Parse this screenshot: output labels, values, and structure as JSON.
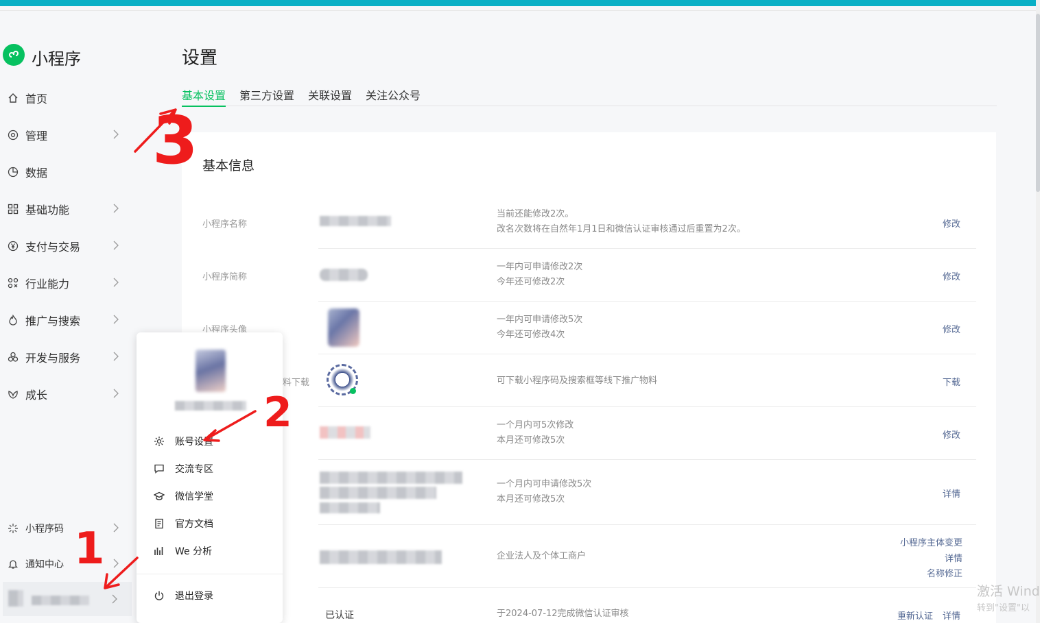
{
  "brand": {
    "name": "小程序"
  },
  "sidebar": {
    "items": [
      {
        "label": "首页",
        "icon": "home-icon"
      },
      {
        "label": "管理",
        "icon": "settings-circle-icon"
      },
      {
        "label": "数据",
        "icon": "pie-chart-icon"
      },
      {
        "label": "基础功能",
        "icon": "grid-icon"
      },
      {
        "label": "支付与交易",
        "icon": "yen-icon"
      },
      {
        "label": "行业能力",
        "icon": "industry-icon"
      },
      {
        "label": "推广与搜索",
        "icon": "flame-icon"
      },
      {
        "label": "开发与服务",
        "icon": "services-icon"
      },
      {
        "label": "成长",
        "icon": "growth-icon"
      }
    ],
    "bottom": [
      {
        "label": "小程序码",
        "icon": "qr-sparkle-icon"
      },
      {
        "label": "通知中心",
        "icon": "bell-icon"
      }
    ]
  },
  "page": {
    "title": "设置",
    "tabs": [
      "基本设置",
      "第三方设置",
      "关联设置",
      "关注公众号"
    ],
    "active_tab": "基本设置",
    "section_title": "基本信息"
  },
  "rows": [
    {
      "label": "小程序名称",
      "desc": [
        "当前还能修改2次。",
        "改名次数将在自然年1月1日和微信认证审核通过后重置为2次。"
      ],
      "actions": [
        "修改"
      ]
    },
    {
      "label": "小程序简称",
      "desc": [
        "一年内可申请修改2次",
        "今年还可修改2次"
      ],
      "actions": [
        "修改"
      ]
    },
    {
      "label": "小程序头像",
      "desc": [
        "一年内可申请修改5次",
        "今年还可修改4次"
      ],
      "actions": [
        "修改"
      ]
    },
    {
      "label": "料下载",
      "desc": [
        "可下载小程序码及搜索框等线下推广物料"
      ],
      "actions": [
        "下载"
      ]
    },
    {
      "label": "",
      "desc": [
        "一个月内可5次修改",
        "本月还可修改5次"
      ],
      "actions": [
        "修改"
      ]
    },
    {
      "label": "",
      "desc": [
        "一个月内可申请修改5次",
        "本月还可修改5次"
      ],
      "actions": [
        "详情"
      ]
    },
    {
      "label": "",
      "desc": [
        "企业法人及个体工商户"
      ],
      "actions": [
        "小程序主体变更",
        "详情",
        "名称修正"
      ]
    },
    {
      "label": "",
      "value": "已认证",
      "desc": [
        "于2024-07-12完成微信认证审核"
      ],
      "actions": [
        "重新认证",
        "详情"
      ]
    }
  ],
  "popup": {
    "items": [
      {
        "label": "账号设置",
        "icon": "gear-icon"
      },
      {
        "label": "交流专区",
        "icon": "chat-icon"
      },
      {
        "label": "微信学堂",
        "icon": "graduation-cap-icon"
      },
      {
        "label": "官方文档",
        "icon": "document-icon"
      },
      {
        "label": "We 分析",
        "icon": "analytics-icon"
      }
    ],
    "logout": {
      "label": "退出登录",
      "icon": "power-icon"
    }
  },
  "annotations": [
    "1",
    "2",
    "3"
  ],
  "watermark": {
    "line1": "激活 Wind",
    "line2": "转到\"设置\"以"
  },
  "colors": {
    "accent": "#07c160",
    "link": "#576b95",
    "topbar": "#0ab0c6",
    "annotation": "#ee1c1c"
  }
}
